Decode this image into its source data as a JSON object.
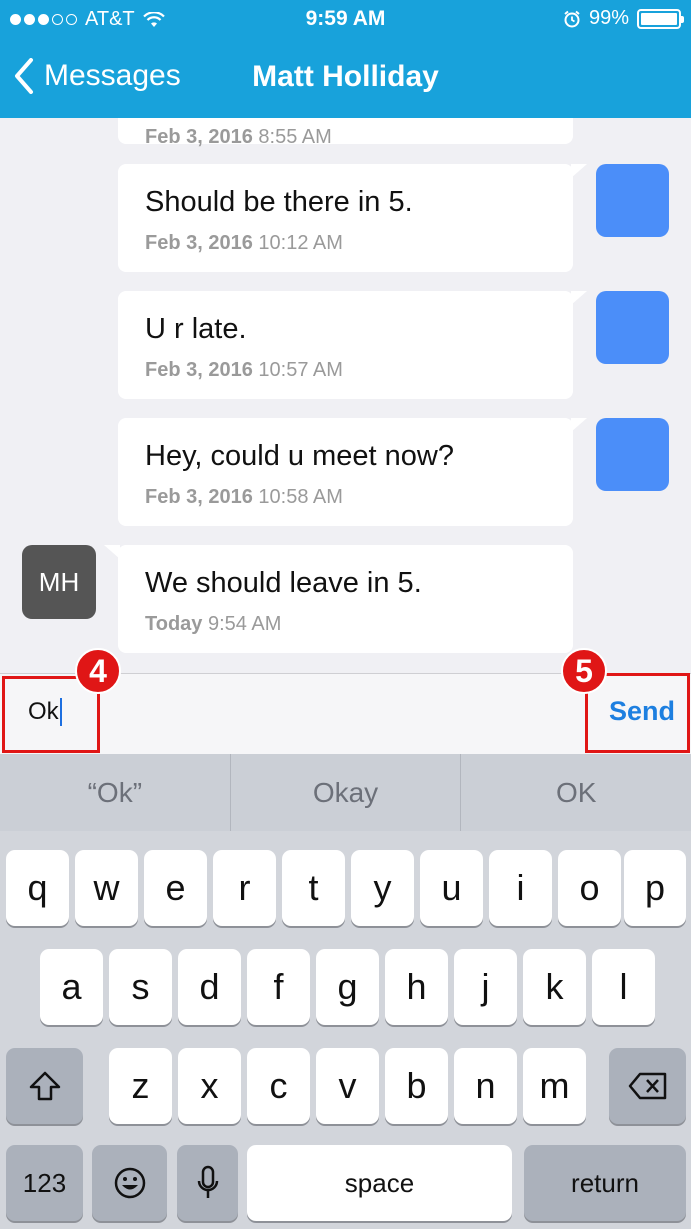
{
  "status_bar": {
    "carrier": "AT&T",
    "time": "9:59 AM",
    "battery": "99%",
    "battery_level": 0.99,
    "signal_bars": 3,
    "signal_total": 5
  },
  "nav": {
    "back_label": "Messages",
    "title": "Matt Holliday"
  },
  "messages": [
    {
      "text": "",
      "date": "Feb 3, 2016",
      "time": "8:55 AM",
      "direction": "out"
    },
    {
      "text": "Should be there in 5.",
      "date": "Feb 3, 2016",
      "time": "10:12 AM",
      "direction": "out"
    },
    {
      "text": "U r late.",
      "date": "Feb 3, 2016",
      "time": "10:57 AM",
      "direction": "out"
    },
    {
      "text": "Hey, could u meet now?",
      "date": "Feb 3, 2016",
      "time": "10:58 AM",
      "direction": "out"
    },
    {
      "text": "We should leave in 5.",
      "date": "Today",
      "time": "9:54 AM",
      "direction": "in",
      "avatar": "MH"
    }
  ],
  "input": {
    "value": "Ok",
    "send_label": "Send",
    "annotation_input": "4",
    "annotation_send": "5"
  },
  "suggestions": [
    "“Ok”",
    "Okay",
    "OK"
  ],
  "keyboard": {
    "row1": [
      "q",
      "w",
      "e",
      "r",
      "t",
      "y",
      "u",
      "i",
      "o",
      "p"
    ],
    "row2": [
      "a",
      "s",
      "d",
      "f",
      "g",
      "h",
      "j",
      "k",
      "l"
    ],
    "row3": [
      "z",
      "x",
      "c",
      "v",
      "b",
      "n",
      "m"
    ],
    "numbers_label": "123",
    "space_label": "space",
    "return_label": "return"
  },
  "colors": {
    "nav_bar": "#18a2db",
    "outgoing_avatar": "#4b8ef9",
    "incoming_avatar": "#555555",
    "send": "#1d7fe0",
    "annotation": "#e01616"
  }
}
